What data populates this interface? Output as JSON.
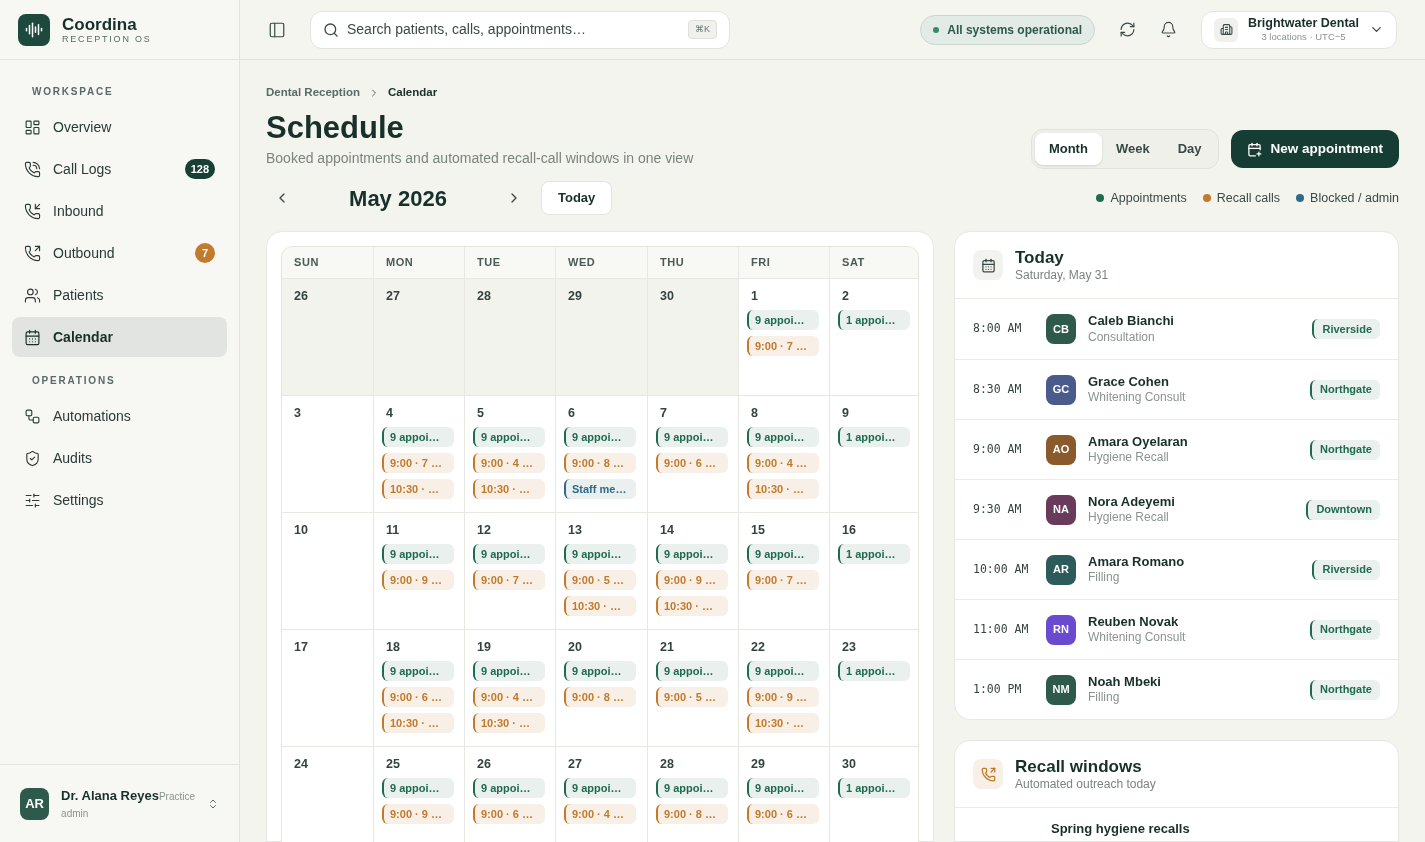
{
  "brand": {
    "name": "Coordina",
    "tagline": "RECEPTION OS"
  },
  "sidebar": {
    "sections": [
      {
        "title": "WORKSPACE",
        "items": [
          {
            "label": "Overview",
            "selected": false
          },
          {
            "label": "Call Logs",
            "selected": false,
            "badge": {
              "text": "128",
              "color": "#173f35"
            }
          },
          {
            "label": "Inbound",
            "selected": false
          },
          {
            "label": "Outbound",
            "selected": false,
            "badge": {
              "text": "7",
              "color": "#c27a2c"
            }
          },
          {
            "label": "Patients",
            "selected": false
          },
          {
            "label": "Calendar",
            "selected": true
          }
        ]
      },
      {
        "title": "OPERATIONS",
        "items": [
          {
            "label": "Automations",
            "selected": false
          },
          {
            "label": "Audits",
            "selected": false
          },
          {
            "label": "Settings",
            "selected": false
          }
        ]
      }
    ],
    "user": {
      "initials": "AR",
      "name": "Dr. Alana Reyes",
      "role_1": "Practice",
      "role_2": "admin"
    }
  },
  "topbar": {
    "search": {
      "placeholder": "Search patients, calls, appointments…",
      "shortcut": "⌘K"
    },
    "status": "All systems operational",
    "org": {
      "name": "Brightwater Dental",
      "detail": "3 locations · UTC−5"
    }
  },
  "breadcrumb": [
    "Dental Reception",
    "Calendar"
  ],
  "title": "Schedule",
  "subtitle": "Booked appointments and automated recall-call windows in one view",
  "views": [
    {
      "label": "Month",
      "selected": true
    },
    {
      "label": "Week",
      "selected": false
    },
    {
      "label": "Day",
      "selected": false
    }
  ],
  "new_button": "New appointment",
  "month": "May 2026",
  "today_button": "Today",
  "legend": [
    {
      "label": "Appointments",
      "color": "#1f6b4f"
    },
    {
      "label": "Recall calls",
      "color": "#c27a2c"
    },
    {
      "label": "Blocked / admin",
      "color": "#2f6a8a"
    }
  ],
  "calendar": {
    "weekdays": [
      "SUN",
      "MON",
      "TUE",
      "WED",
      "THU",
      "FRI",
      "SAT"
    ],
    "weeks": [
      [
        {
          "date": "26",
          "muted": true
        },
        {
          "date": "27",
          "muted": true
        },
        {
          "date": "28",
          "muted": true
        },
        {
          "date": "29",
          "muted": true
        },
        {
          "date": "30",
          "muted": true
        },
        {
          "date": "1",
          "muted": false,
          "events": [
            {
              "kind": "appointment",
              "label": "9 appoi…"
            },
            {
              "kind": "recall",
              "label": "9:00 · 7 …"
            }
          ]
        },
        {
          "date": "2",
          "muted": false,
          "events": [
            {
              "kind": "appointment",
              "label": "1 appoi…"
            }
          ]
        }
      ],
      [
        {
          "date": "3",
          "muted": false
        },
        {
          "date": "4",
          "muted": false,
          "events": [
            {
              "kind": "appointment",
              "label": "9 appoi…"
            },
            {
              "kind": "recall",
              "label": "9:00 · 7 …"
            },
            {
              "kind": "recall",
              "label": "10:30 · …"
            }
          ]
        },
        {
          "date": "5",
          "muted": false,
          "events": [
            {
              "kind": "appointment",
              "label": "9 appoi…"
            },
            {
              "kind": "recall",
              "label": "9:00 · 4 …"
            },
            {
              "kind": "recall",
              "label": "10:30 · …"
            }
          ]
        },
        {
          "date": "6",
          "muted": false,
          "events": [
            {
              "kind": "appointment",
              "label": "9 appoi…"
            },
            {
              "kind": "recall",
              "label": "9:00 · 8 …"
            },
            {
              "kind": "blocked",
              "label": "Staff me…"
            }
          ]
        },
        {
          "date": "7",
          "muted": false,
          "events": [
            {
              "kind": "appointment",
              "label": "9 appoi…"
            },
            {
              "kind": "recall",
              "label": "9:00 · 6 …"
            }
          ]
        },
        {
          "date": "8",
          "muted": false,
          "events": [
            {
              "kind": "appointment",
              "label": "9 appoi…"
            },
            {
              "kind": "recall",
              "label": "9:00 · 4 …"
            },
            {
              "kind": "recall",
              "label": "10:30 · …"
            }
          ]
        },
        {
          "date": "9",
          "muted": false,
          "events": [
            {
              "kind": "appointment",
              "label": "1 appoi…"
            }
          ]
        }
      ],
      [
        {
          "date": "10",
          "muted": false
        },
        {
          "date": "11",
          "muted": false,
          "events": [
            {
              "kind": "appointment",
              "label": "9 appoi…"
            },
            {
              "kind": "recall",
              "label": "9:00 · 9 …"
            }
          ]
        },
        {
          "date": "12",
          "muted": false,
          "events": [
            {
              "kind": "appointment",
              "label": "9 appoi…"
            },
            {
              "kind": "recall",
              "label": "9:00 · 7 …"
            }
          ]
        },
        {
          "date": "13",
          "muted": false,
          "events": [
            {
              "kind": "appointment",
              "label": "9 appoi…"
            },
            {
              "kind": "recall",
              "label": "9:00 · 5 …"
            },
            {
              "kind": "recall",
              "label": "10:30 · …"
            }
          ]
        },
        {
          "date": "14",
          "muted": false,
          "events": [
            {
              "kind": "appointment",
              "label": "9 appoi…"
            },
            {
              "kind": "recall",
              "label": "9:00 · 9 …"
            },
            {
              "kind": "recall",
              "label": "10:30 · …"
            }
          ]
        },
        {
          "date": "15",
          "muted": false,
          "events": [
            {
              "kind": "appointment",
              "label": "9 appoi…"
            },
            {
              "kind": "recall",
              "label": "9:00 · 7 …"
            }
          ]
        },
        {
          "date": "16",
          "muted": false,
          "events": [
            {
              "kind": "appointment",
              "label": "1 appoi…"
            }
          ]
        }
      ],
      [
        {
          "date": "17",
          "muted": false
        },
        {
          "date": "18",
          "muted": false,
          "events": [
            {
              "kind": "appointment",
              "label": "9 appoi…"
            },
            {
              "kind": "recall",
              "label": "9:00 · 6 …"
            },
            {
              "kind": "recall",
              "label": "10:30 · …"
            }
          ]
        },
        {
          "date": "19",
          "muted": false,
          "events": [
            {
              "kind": "appointment",
              "label": "9 appoi…"
            },
            {
              "kind": "recall",
              "label": "9:00 · 4 …"
            },
            {
              "kind": "recall",
              "label": "10:30 · …"
            }
          ]
        },
        {
          "date": "20",
          "muted": false,
          "events": [
            {
              "kind": "appointment",
              "label": "9 appoi…"
            },
            {
              "kind": "recall",
              "label": "9:00 · 8 …"
            }
          ]
        },
        {
          "date": "21",
          "muted": false,
          "events": [
            {
              "kind": "appointment",
              "label": "9 appoi…"
            },
            {
              "kind": "recall",
              "label": "9:00 · 5 …"
            }
          ]
        },
        {
          "date": "22",
          "muted": false,
          "events": [
            {
              "kind": "appointment",
              "label": "9 appoi…"
            },
            {
              "kind": "recall",
              "label": "9:00 · 9 …"
            },
            {
              "kind": "recall",
              "label": "10:30 · …"
            }
          ]
        },
        {
          "date": "23",
          "muted": false,
          "events": [
            {
              "kind": "appointment",
              "label": "1 appoi…"
            }
          ]
        }
      ],
      [
        {
          "date": "24",
          "muted": false
        },
        {
          "date": "25",
          "muted": false,
          "events": [
            {
              "kind": "appointment",
              "label": "9 appoi…"
            },
            {
              "kind": "recall",
              "label": "9:00 · 9 …"
            }
          ]
        },
        {
          "date": "26",
          "muted": false,
          "events": [
            {
              "kind": "appointment",
              "label": "9 appoi…"
            },
            {
              "kind": "recall",
              "label": "9:00 · 6 …"
            }
          ]
        },
        {
          "date": "27",
          "muted": false,
          "events": [
            {
              "kind": "appointment",
              "label": "9 appoi…"
            },
            {
              "kind": "recall",
              "label": "9:00 · 4 …"
            }
          ]
        },
        {
          "date": "28",
          "muted": false,
          "events": [
            {
              "kind": "appointment",
              "label": "9 appoi…"
            },
            {
              "kind": "recall",
              "label": "9:00 · 8 …"
            }
          ]
        },
        {
          "date": "29",
          "muted": false,
          "events": [
            {
              "kind": "appointment",
              "label": "9 appoi…"
            },
            {
              "kind": "recall",
              "label": "9:00 · 6 …"
            }
          ]
        },
        {
          "date": "30",
          "muted": false,
          "events": [
            {
              "kind": "appointment",
              "label": "1 appoi…"
            }
          ]
        }
      ]
    ]
  },
  "today": {
    "title": "Today",
    "date": "Saturday, May 31",
    "items": [
      {
        "time": "8:00 AM",
        "initials": "CB",
        "color": "#2d5a4a",
        "name": "Caleb Bianchi",
        "type": "Consultation",
        "location": "Riverside"
      },
      {
        "time": "8:30 AM",
        "initials": "GC",
        "color": "#4a5a8a",
        "name": "Grace Cohen",
        "type": "Whitening Consult",
        "location": "Northgate"
      },
      {
        "time": "9:00 AM",
        "initials": "AO",
        "color": "#8a5a2a",
        "name": "Amara Oyelaran",
        "type": "Hygiene Recall",
        "location": "Northgate"
      },
      {
        "time": "9:30 AM",
        "initials": "NA",
        "color": "#6a3a5a",
        "name": "Nora Adeyemi",
        "type": "Hygiene Recall",
        "location": "Downtown"
      },
      {
        "time": "10:00 AM",
        "initials": "AR",
        "color": "#2d5a5a",
        "name": "Amara Romano",
        "type": "Filling",
        "location": "Riverside"
      },
      {
        "time": "11:00 AM",
        "initials": "RN",
        "color": "#6a4acf",
        "name": "Reuben Novak",
        "type": "Whitening Consult",
        "location": "Northgate"
      },
      {
        "time": "1:00 PM",
        "initials": "NM",
        "color": "#2d5a4a",
        "name": "Noah Mbeki",
        "type": "Filling",
        "location": "Northgate"
      }
    ]
  },
  "recall": {
    "title": "Recall windows",
    "subtitle": "Automated outreach today",
    "items": [
      {
        "name": "Spring hygiene recalls"
      }
    ]
  }
}
